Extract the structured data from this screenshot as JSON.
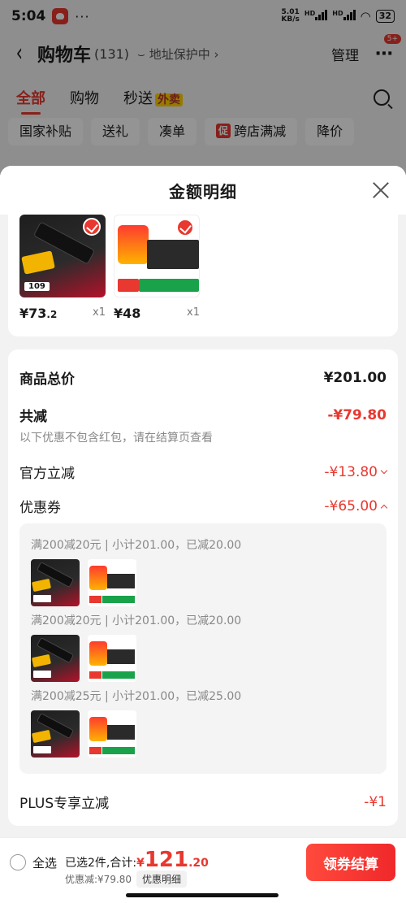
{
  "status_bar": {
    "time": "5:04",
    "dots": "···",
    "speed_value": "5.01",
    "speed_unit": "KB/s",
    "net_1": "HD",
    "net_2": "HD",
    "battery": "32"
  },
  "header": {
    "title": "购物车",
    "count": "(131)",
    "address": "地址保护中",
    "manage": "管理",
    "badge": "5+"
  },
  "tabs": {
    "all": "全部",
    "shopping": "购物",
    "flash": "秒送",
    "flash_tag": "外卖"
  },
  "chips": {
    "items": [
      "国家补贴",
      "送礼",
      "凑单",
      "跨店满减",
      "降价"
    ],
    "promo_mark": "促"
  },
  "sheet": {
    "title": "金额明细",
    "goods": [
      {
        "price_main": "¥73",
        "price_dec": ".2",
        "qty": "x1",
        "thumb_price": "109"
      },
      {
        "price_main": "¥48",
        "price_dec": "",
        "qty": "x1"
      }
    ],
    "summary": {
      "total_label": "商品总价",
      "total_value": "¥201.00",
      "reduce_label": "共减",
      "reduce_value": "-¥79.80",
      "note": "以下优惠不包含红包，请在结算页查看",
      "official_label": "官方立减",
      "official_value": "-¥13.80",
      "coupon_label": "优惠券",
      "coupon_value": "-¥65.00",
      "coupons": [
        "满200减20元 | 小计201.00，已减20.00",
        "满200减20元 | 小计201.00，已减20.00",
        "满200减25元 | 小计201.00，已减25.00"
      ],
      "plus_label": "PLUS专享立减",
      "plus_value": "-¥1"
    }
  },
  "bottom": {
    "select_all": "全选",
    "selected": "已选2件,合计:",
    "total_yen": "¥",
    "total_int": "121",
    "total_dec": ".20",
    "discount": "优惠减:¥79.80",
    "detail": "优惠明细",
    "checkout": "领券结算"
  },
  "colors": {
    "accent": "#e8382f",
    "green": "#19a24a"
  }
}
